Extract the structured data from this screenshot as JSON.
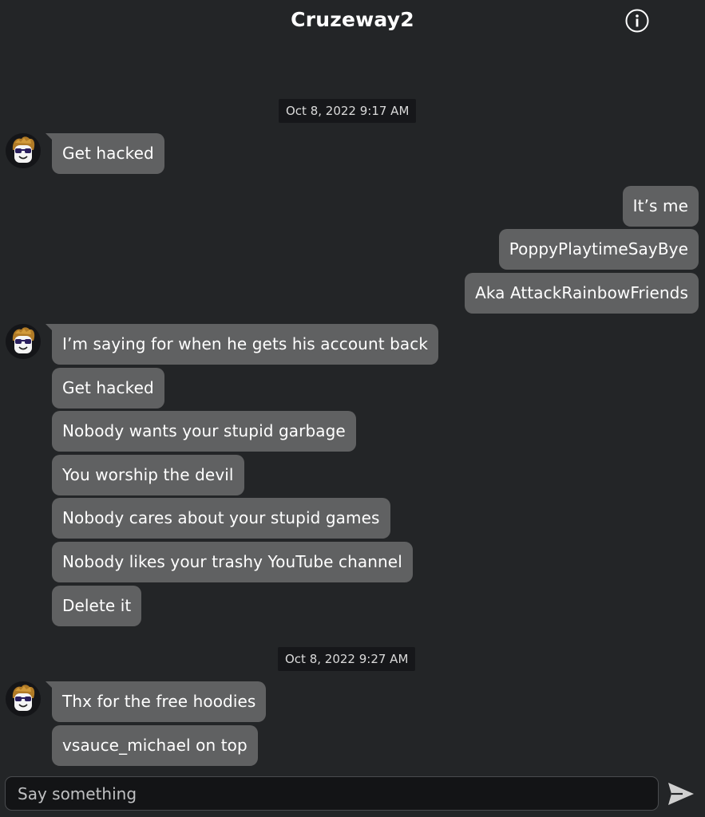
{
  "header": {
    "title": "Cruzeway2",
    "info_icon": "info-circle-icon"
  },
  "messages": {
    "timestamps": [
      "Oct 8, 2022 9:17 AM",
      "Oct 8, 2022 9:27 AM"
    ],
    "group1_incoming": [
      "Get hacked"
    ],
    "outgoing": [
      "It’s me",
      "PoppyPlaytimeSayBye",
      "Aka AttackRainbowFriends"
    ],
    "group2_incoming": [
      "I’m saying for when he gets his account back",
      "Get hacked",
      "Nobody wants your stupid garbage",
      "You worship the devil",
      "Nobody cares about your stupid games",
      "Nobody likes your trashy YouTube channel",
      "Delete it"
    ],
    "group3_incoming": [
      "Thx for the free hoodies",
      "vsauce_michael on top"
    ]
  },
  "composer": {
    "placeholder": "Say something",
    "value": "",
    "send_icon": "send-arrow-icon"
  },
  "colors": {
    "background": "#232527",
    "bubble": "#606162",
    "timestamp_bg": "#16171a",
    "input_bg": "#131416"
  }
}
